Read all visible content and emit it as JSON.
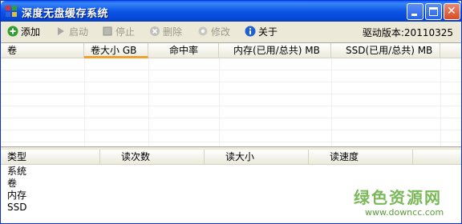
{
  "window": {
    "title": "深度无盘缓存系统"
  },
  "toolbar": {
    "add": "添加",
    "start": "启动",
    "stop": "停止",
    "delete": "删除",
    "modify": "修改",
    "about": "关于",
    "driver_version": "驱动版本:20110325"
  },
  "volume_table": {
    "columns": [
      "卷",
      "卷大小 GB",
      "命中率",
      "内存(已用/总共) MB",
      "SSD(已用/总共) MB"
    ],
    "sorted_column": "卷大小 GB"
  },
  "stats_table": {
    "columns": [
      "类型",
      "读次数",
      "读大小",
      "读速度"
    ],
    "rows": [
      "系统",
      "卷",
      "内存",
      "SSD"
    ]
  },
  "watermark": {
    "text": "绿色资源网",
    "url": "www.downcc.com"
  },
  "colors": {
    "titlebar": "#0a5ff0",
    "window_bg": "#ece9d8",
    "sort_indicator": "#f0a030",
    "watermark": "#7ab85a"
  }
}
